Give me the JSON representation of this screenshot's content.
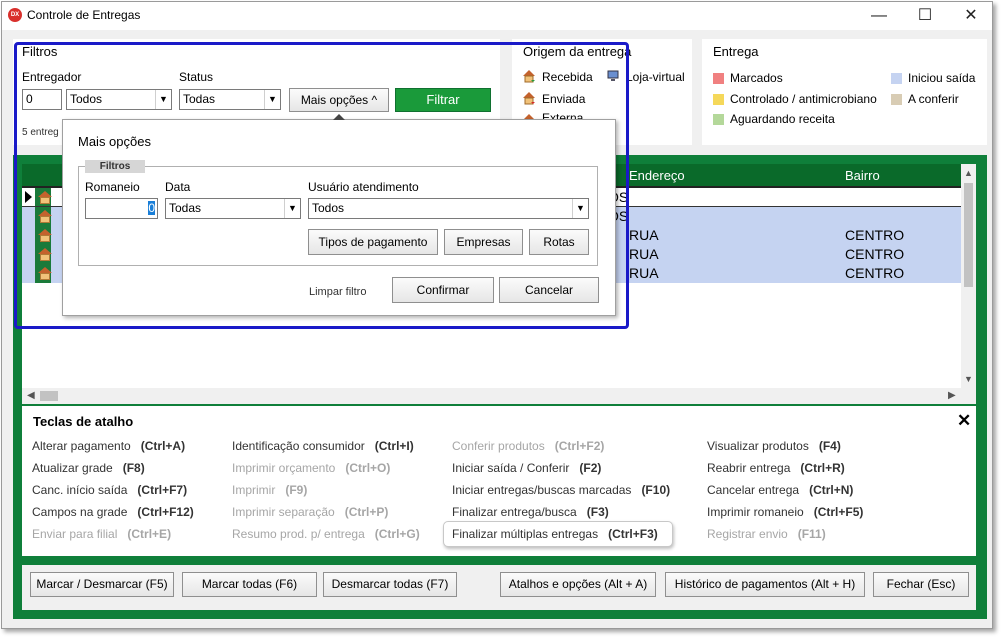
{
  "window": {
    "title": "Controle de Entregas",
    "app_icon_text": "DX",
    "minimize_glyph": "—",
    "maximize_glyph": "☐",
    "close_glyph": "✕"
  },
  "filters": {
    "title": "Filtros",
    "entregador_label": "Entregador",
    "entregador_code": "0",
    "entregador_value": "Todos",
    "status_label": "Status",
    "status_value": "Todas",
    "mais_opcoes_label": "Mais opções",
    "filtrar_label": "Filtrar",
    "count_text": "5 entreg"
  },
  "origem": {
    "title": "Origem da entrega",
    "items": [
      "Recebida",
      "Loja-virtual",
      "Enviada",
      "Externa"
    ]
  },
  "legend": {
    "title": "Entrega",
    "items": [
      {
        "label": "Marcados",
        "color": "#f08080"
      },
      {
        "label": "Iniciou saída",
        "color": "#c5d3f1"
      },
      {
        "label": "Controlado / antimicrobiano",
        "color": "#f5d85a"
      },
      {
        "label": "A conferir",
        "color": "#d8ccb4"
      },
      {
        "label": "Aguardando receita",
        "color": "#b4d89a"
      }
    ]
  },
  "popup": {
    "title": "Mais opções",
    "group_label": "Filtros",
    "romaneio_label": "Romaneio",
    "romaneio_value": "0",
    "data_label": "Data",
    "data_value": "Todas",
    "usuario_label": "Usuário atendimento",
    "usuario_value": "Todos",
    "tipos_pagamento_label": "Tipos de pagamento",
    "empresas_label": "Empresas",
    "rotas_label": "Rotas",
    "limpar_label": "Limpar filtro",
    "confirmar_label": "Confirmar",
    "cancelar_label": "Cancelar"
  },
  "grid": {
    "columns": [
      "Endereço",
      "Bairro"
    ],
    "rows": [
      {
        "endereco": "",
        "bairro": "",
        "fragment": "OS"
      },
      {
        "endereco": "",
        "bairro": "",
        "fragment": "OS"
      },
      {
        "endereco": "RUA",
        "bairro": "CENTRO",
        "fragment": ""
      },
      {
        "endereco": "RUA",
        "bairro": "CENTRO",
        "fragment": ""
      },
      {
        "endereco": "RUA",
        "bairro": "CENTRO",
        "fragment": ""
      }
    ]
  },
  "shortcuts": {
    "title": "Teclas de atalho",
    "items": [
      {
        "label": "Alterar pagamento",
        "key": "(Ctrl+A)",
        "enabled": true
      },
      {
        "label": "Atualizar grade",
        "key": "(F8)",
        "enabled": true
      },
      {
        "label": "Canc. início saída",
        "key": "(Ctrl+F7)",
        "enabled": true
      },
      {
        "label": "Campos na grade",
        "key": "(Ctrl+F12)",
        "enabled": true
      },
      {
        "label": "Enviar para filial",
        "key": "(Ctrl+E)",
        "enabled": false
      },
      {
        "label": "Identificação consumidor",
        "key": "(Ctrl+I)",
        "enabled": true
      },
      {
        "label": "Imprimir orçamento",
        "key": "(Ctrl+O)",
        "enabled": false
      },
      {
        "label": "Imprimir",
        "key": "(F9)",
        "enabled": false
      },
      {
        "label": "Imprimir separação",
        "key": "(Ctrl+P)",
        "enabled": false
      },
      {
        "label": "Resumo prod. p/ entrega",
        "key": "(Ctrl+G)",
        "enabled": false
      },
      {
        "label": "Conferir produtos",
        "key": "(Ctrl+F2)",
        "enabled": false
      },
      {
        "label": "Iniciar saída / Conferir",
        "key": "(F2)",
        "enabled": true
      },
      {
        "label": "Iniciar entregas/buscas marcadas",
        "key": "(F10)",
        "enabled": true
      },
      {
        "label": "Finalizar entrega/busca",
        "key": "(F3)",
        "enabled": true
      },
      {
        "label": "Finalizar múltiplas entregas",
        "key": "(Ctrl+F3)",
        "enabled": true
      },
      {
        "label": "Visualizar produtos",
        "key": "(F4)",
        "enabled": true
      },
      {
        "label": "Reabrir entrega",
        "key": "(Ctrl+R)",
        "enabled": true
      },
      {
        "label": "Cancelar entrega",
        "key": "(Ctrl+N)",
        "enabled": true
      },
      {
        "label": "Imprimir romaneio",
        "key": "(Ctrl+F5)",
        "enabled": true
      },
      {
        "label": "Registrar envio",
        "key": "(F11)",
        "enabled": false
      }
    ]
  },
  "bottom_buttons": {
    "marcar_desmarcar": "Marcar / Desmarcar (F5)",
    "marcar_todas": "Marcar todas (F6)",
    "desmarcar_todas": "Desmarcar todas (F7)",
    "atalhos": "Atalhos e opções (Alt + A)",
    "historico": "Histórico de pagamentos (Alt + H)",
    "fechar": "Fechar (Esc)"
  },
  "colors": {
    "grid_frame": "#0f7f3a",
    "grid_header": "#0a6a2a",
    "row_highlight": "#c5d3f1",
    "filter_button": "#1a9a3a",
    "focus_outline": "#1a1ac8"
  }
}
